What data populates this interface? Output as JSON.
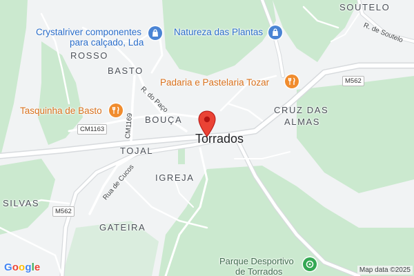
{
  "map": {
    "center_town": "Torrados",
    "areas": [
      "SOUTELO",
      "ROSSO",
      "BASTO",
      "BOUÇA",
      "TOJAL",
      "IGREJA",
      "CRUZ DAS",
      "ALMAS",
      "SILVAS",
      "GATEIRA"
    ],
    "streets": [
      "R. de Soutelo",
      "R. do Paço",
      "CM1169",
      "Rua de Cucos"
    ],
    "route_shields": [
      "M562",
      "CM1163",
      "M562"
    ],
    "pois": {
      "crystalriver_line1": "Crystalriver componentes",
      "crystalriver_line2": "para calçado, Lda",
      "natureza": "Natureza das Plantas",
      "padaria": "Padaria e Pastelaria Tozar",
      "tasquinha": "Tasquinha de Basto",
      "parque_line1": "Parque Desportivo",
      "parque_line2": "de Torrados"
    },
    "icons": {
      "shopping": "shopping-bag-icon",
      "food": "restaurant-icon",
      "park": "park-icon",
      "pin": "location-pin-icon"
    },
    "colors": {
      "land": "#f1f3f4",
      "green": "#cbe9cf",
      "road": "#ffffff",
      "road_outline": "#d7dadd",
      "poi_blue": "#2a6dc9",
      "poi_orange": "#d8701c",
      "poi_green": "#3f6b4d",
      "pin_red": "#ea4335"
    },
    "logo": [
      "G",
      "o",
      "o",
      "g",
      "l",
      "e"
    ],
    "attribution": "Map data ©2025"
  }
}
